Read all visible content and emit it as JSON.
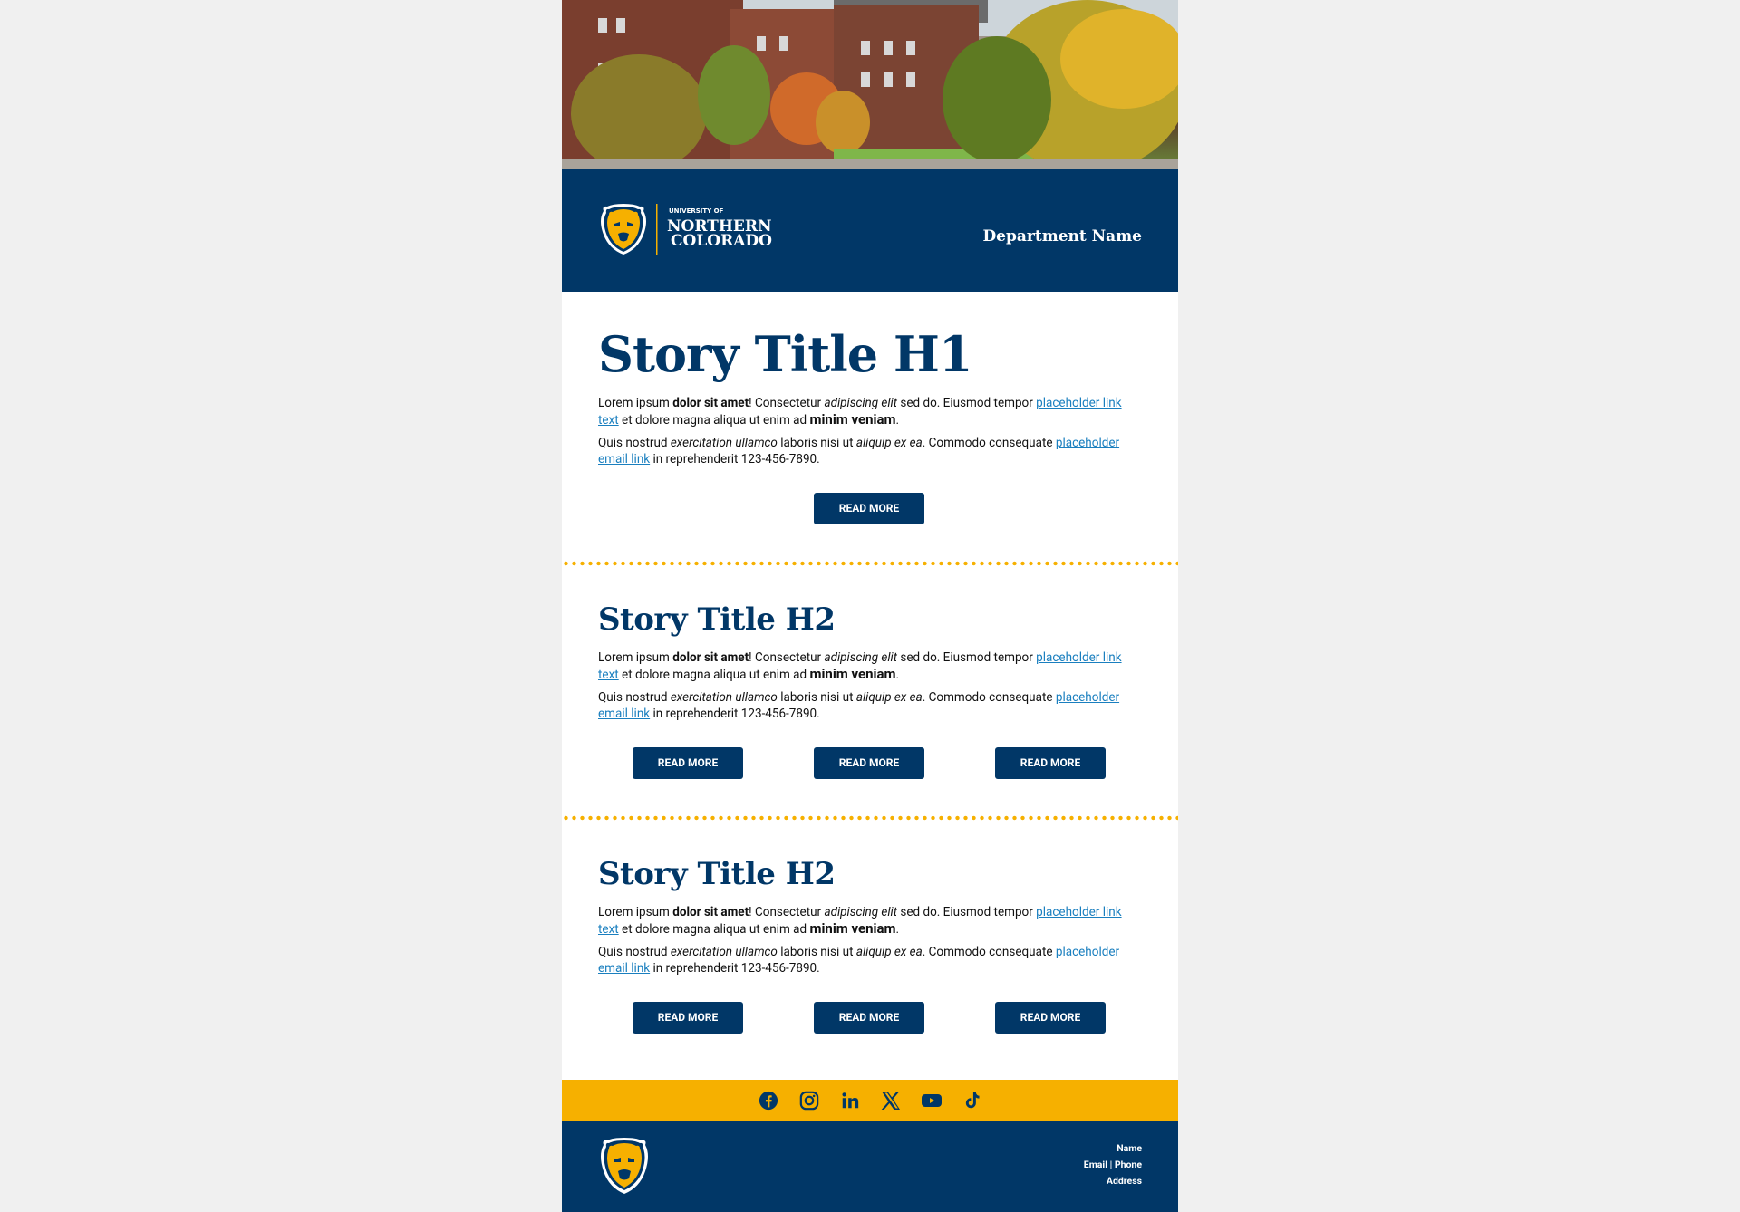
{
  "header": {
    "logo_text_small": "UNIVERSITY OF",
    "logo_text_line1": "NORTHERN",
    "logo_text_line2": "COLORADO",
    "department": "Department Name"
  },
  "stories": [
    {
      "title": "Story Title H1",
      "p1": {
        "a": "Lorem ipsum ",
        "b": "dolor sit amet",
        "c": "! Consectetur ",
        "d": "adipiscing elit",
        "e": " sed do. Eiusmod tempor ",
        "link": "placeholder link text",
        "f": " et dolore magna aliqua ut enim ad ",
        "g": "minim veniam",
        "h": "."
      },
      "p2": {
        "a": "Quis nostrud ",
        "b": "exercitation ullamco",
        "c": " laboris nisi ut ",
        "d": "aliquip ex ea",
        "e": ". Commodo consequate ",
        "link": "placeholder email link",
        "f": " in reprehenderit 123-456-7890."
      },
      "buttons": [
        "READ MORE"
      ]
    },
    {
      "title": "Story Title H2",
      "p1": {
        "a": "Lorem ipsum ",
        "b": "dolor sit amet",
        "c": "! Consectetur ",
        "d": "adipiscing elit",
        "e": " sed do. Eiusmod tempor ",
        "link": "placeholder link text",
        "f": " et dolore magna aliqua ut enim ad ",
        "g": "minim veniam",
        "h": "."
      },
      "p2": {
        "a": "Quis nostrud ",
        "b": "exercitation ullamco",
        "c": " laboris nisi ut ",
        "d": "aliquip ex ea",
        "e": ". Commodo consequate ",
        "link": "placeholder email link",
        "f": " in reprehenderit 123-456-7890."
      },
      "buttons": [
        "READ MORE",
        "READ MORE",
        "READ MORE"
      ]
    },
    {
      "title": "Story Title H2",
      "p1": {
        "a": "Lorem ipsum ",
        "b": "dolor sit amet",
        "c": "! Consectetur ",
        "d": "adipiscing elit",
        "e": " sed do. Eiusmod tempor ",
        "link": "placeholder link text",
        "f": " et dolore magna aliqua ut enim ad ",
        "g": "minim veniam",
        "h": "."
      },
      "p2": {
        "a": "Quis nostrud ",
        "b": "exercitation ullamco",
        "c": " laboris nisi ut ",
        "d": "aliquip ex ea",
        "e": ". Commodo consequate ",
        "link": "placeholder email link",
        "f": " in reprehenderit 123-456-7890."
      },
      "buttons": [
        "READ MORE",
        "READ MORE",
        "READ MORE"
      ]
    }
  ],
  "social": [
    "facebook-icon",
    "instagram-icon",
    "linkedin-icon",
    "x-icon",
    "youtube-icon",
    "tiktok-icon"
  ],
  "footer": {
    "name": "Name",
    "email": "Email",
    "sep": " | ",
    "phone": "Phone",
    "address": "Address"
  },
  "colors": {
    "navy": "#013767",
    "gold": "#f6b000",
    "link": "#1a7fbf",
    "page_bg": "#f0f0f0"
  }
}
